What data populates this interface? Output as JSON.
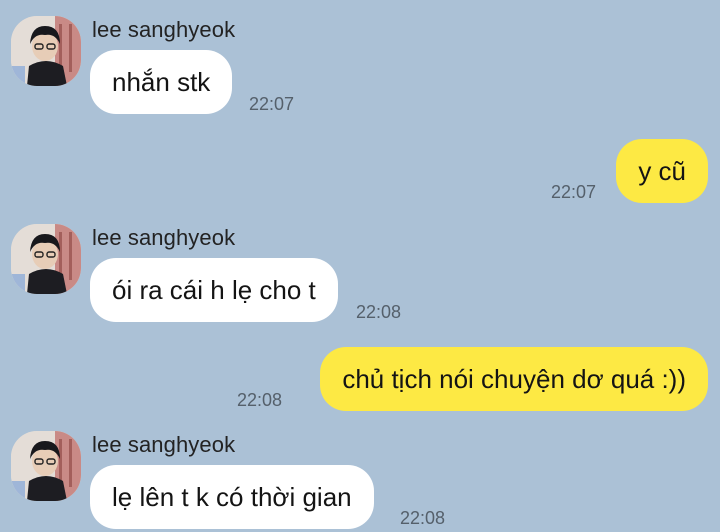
{
  "messages": [
    {
      "sender": "lee sanghyeok",
      "text": "nhắn stk",
      "time": "22:07"
    },
    {
      "text": "y cũ",
      "time": "22:07"
    },
    {
      "sender": "lee sanghyeok",
      "text": "ói ra cái h lẹ cho t",
      "time": "22:08"
    },
    {
      "text": "chủ tịch nói chuyện dơ quá :))",
      "time": "22:08"
    },
    {
      "sender": "lee sanghyeok",
      "text": "lẹ lên t k có thời gian",
      "time": "22:08"
    }
  ],
  "colors": {
    "background": "#abc1d6",
    "incoming_bubble": "#ffffff",
    "outgoing_bubble": "#fde944",
    "timestamp": "#55606b"
  }
}
